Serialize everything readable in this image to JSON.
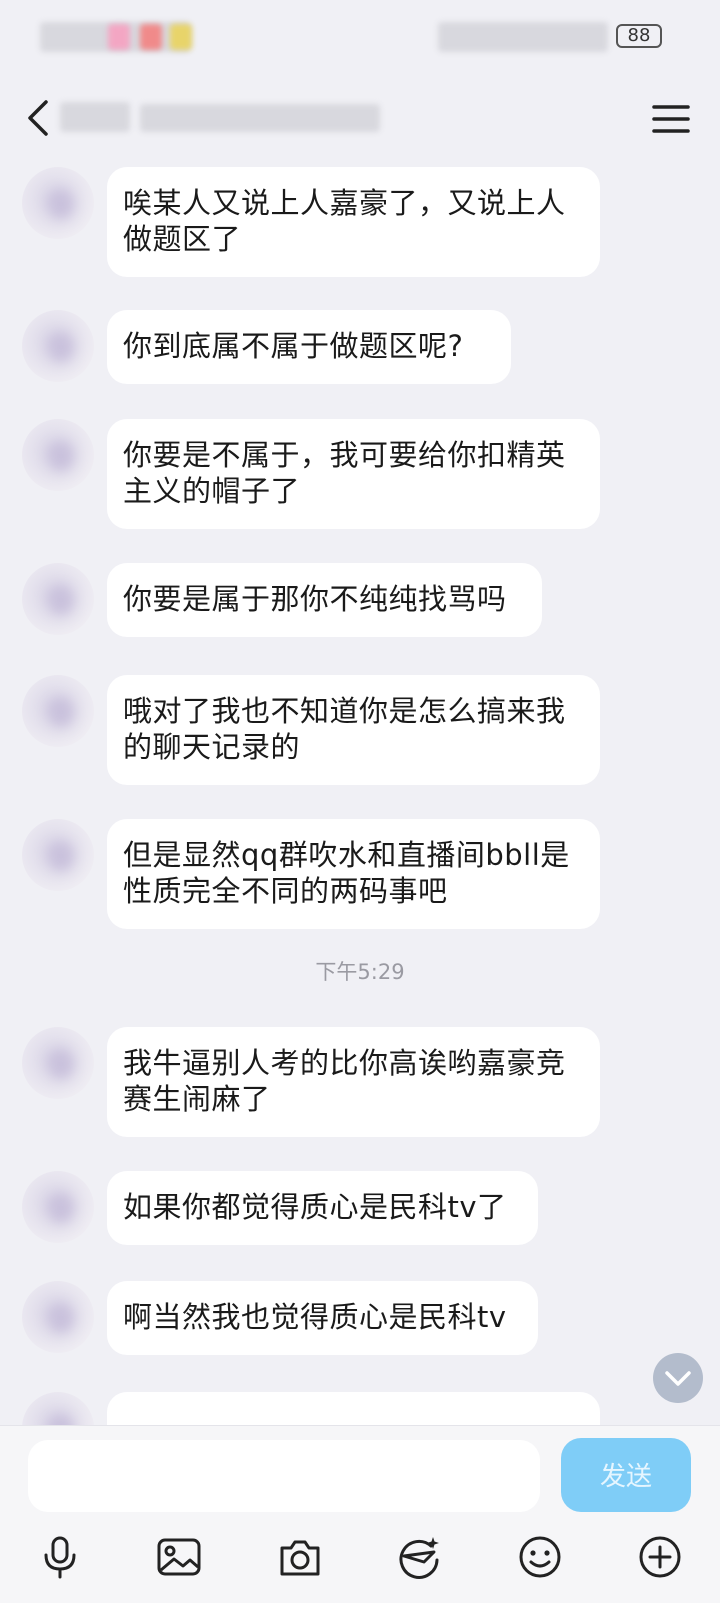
{
  "status_bar": {
    "battery": "88"
  },
  "messages": [
    {
      "text": "唉某人又说上人嘉豪了，又说上人做题区了"
    },
    {
      "text": "你到底属不属于做题区呢?"
    },
    {
      "text": "你要是不属于，我可要给你扣精英主义的帽子了"
    },
    {
      "text": "你要是属于那你不纯纯找骂吗"
    },
    {
      "text": "哦对了我也不知道你是怎么搞来我的聊天记录的"
    },
    {
      "text": "但是显然qq群吹水和直播间bbll是性质完全不同的两码事吧"
    },
    {
      "text": "我牛逼别人考的比你高诶哟嘉豪竞赛生闹麻了"
    },
    {
      "text": "如果你都觉得质心是民科tv了"
    },
    {
      "text": "啊当然我也觉得质心是民科tv"
    }
  ],
  "time_separator": "下午5:29",
  "input": {
    "value": "",
    "placeholder": ""
  },
  "send_label": "发送",
  "icons": {
    "back": "back-icon",
    "menu": "menu-icon",
    "scroll_down": "chevron-down-icon",
    "toolbar": [
      "microphone-icon",
      "image-icon",
      "camera-icon",
      "sticker-icon",
      "emoji-icon",
      "plus-icon"
    ]
  },
  "colors": {
    "background": "#f0f0f5",
    "bubble": "#ffffff",
    "send_button": "#7fcdf7"
  }
}
